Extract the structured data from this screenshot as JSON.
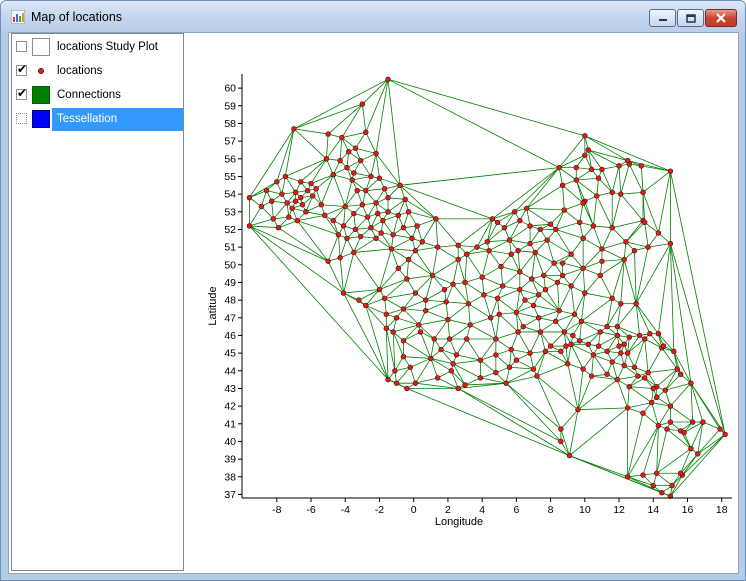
{
  "window": {
    "title": "Map of locations"
  },
  "legend": {
    "items": [
      {
        "label": "locations Study Plot",
        "checked": false,
        "swatch": "white-box",
        "fill": "#ffffff",
        "border": "#8e8f8f"
      },
      {
        "label": "locations",
        "checked": true,
        "swatch": "red-dot",
        "fill": "#e8191a"
      },
      {
        "label": "Connections",
        "checked": true,
        "swatch": "green-box",
        "fill": "#008000"
      },
      {
        "label": "Tessellation",
        "checked": false,
        "swatch": "blue-box",
        "fill": "#0000ff",
        "selected": true
      }
    ]
  },
  "colors": {
    "point_fill": "#e8191a",
    "point_stroke": "#3a1010",
    "edge": "#008000",
    "selection": "#3399ff"
  },
  "chart_data": {
    "type": "scatter",
    "xlabel": "Longitude",
    "ylabel": "Latitude",
    "xlim": [
      -9.8,
      18.6
    ],
    "ylim": [
      36.8,
      60.8
    ],
    "xticks": [
      -8,
      -6,
      -4,
      -2,
      0,
      2,
      4,
      6,
      8,
      10,
      12,
      14,
      16,
      18
    ],
    "yticks": [
      37,
      38,
      39,
      40,
      41,
      42,
      43,
      44,
      45,
      46,
      47,
      48,
      49,
      50,
      51,
      52,
      53,
      54,
      55,
      56,
      57,
      58,
      59,
      60
    ],
    "grid": false,
    "legend": "left-panel",
    "description_edges": "Delaunay triangulation connecting all locations",
    "points": [
      [
        -1.5,
        60.5
      ],
      [
        -3.0,
        59.1
      ],
      [
        -7.0,
        57.7
      ],
      [
        -5.0,
        57.4
      ],
      [
        -2.8,
        57.5
      ],
      [
        -3.4,
        56.6
      ],
      [
        -3.8,
        56.4
      ],
      [
        -5.1,
        56.0
      ],
      [
        -3.1,
        55.9
      ],
      [
        -4.3,
        55.9
      ],
      [
        -3.5,
        55.2
      ],
      [
        -2.5,
        55.0
      ],
      [
        -3.6,
        54.8
      ],
      [
        -2.0,
        54.9
      ],
      [
        -7.5,
        55.0
      ],
      [
        -6.6,
        54.7
      ],
      [
        -6.0,
        54.6
      ],
      [
        -8.0,
        54.7
      ],
      [
        -6.2,
        54.2
      ],
      [
        -6.9,
        54.1
      ],
      [
        -7.7,
        54.0
      ],
      [
        -8.6,
        54.2
      ],
      [
        -9.6,
        53.8
      ],
      [
        -8.9,
        53.3
      ],
      [
        -7.1,
        53.2
      ],
      [
        -6.5,
        53.4
      ],
      [
        -6.3,
        53.0
      ],
      [
        -7.3,
        52.7
      ],
      [
        -8.2,
        52.6
      ],
      [
        -6.8,
        52.5
      ],
      [
        -7.9,
        52.1
      ],
      [
        -9.6,
        52.2
      ],
      [
        -5.4,
        53.4
      ],
      [
        -4.0,
        53.3
      ],
      [
        -3.0,
        53.4
      ],
      [
        -2.2,
        53.5
      ],
      [
        -1.5,
        53.8
      ],
      [
        -0.5,
        53.7
      ],
      [
        -3.5,
        52.9
      ],
      [
        -2.7,
        52.7
      ],
      [
        -1.8,
        52.5
      ],
      [
        -0.9,
        52.8
      ],
      [
        -2.5,
        52.1
      ],
      [
        -3.4,
        52.0
      ],
      [
        -4.1,
        52.2
      ],
      [
        -3.1,
        51.6
      ],
      [
        -2.2,
        51.5
      ],
      [
        -1.2,
        51.7
      ],
      [
        -0.1,
        51.5
      ],
      [
        0.5,
        51.3
      ],
      [
        1.3,
        52.6
      ],
      [
        0.2,
        52.2
      ],
      [
        -1.5,
        53.0
      ],
      [
        -0.8,
        54.5
      ],
      [
        -2.8,
        54.2
      ],
      [
        -4.4,
        51.7
      ],
      [
        -4.3,
        50.4
      ],
      [
        -3.5,
        50.7
      ],
      [
        -5.0,
        50.2
      ],
      [
        -1.3,
        50.9
      ],
      [
        0.1,
        50.8
      ],
      [
        1.4,
        51.0
      ],
      [
        2.3,
        48.9
      ],
      [
        1.1,
        49.4
      ],
      [
        3.1,
        50.6
      ],
      [
        4.4,
        50.8
      ],
      [
        4.9,
        52.4
      ],
      [
        5.3,
        52.1
      ],
      [
        6.6,
        53.2
      ],
      [
        7.1,
        50.7
      ],
      [
        6.8,
        51.2
      ],
      [
        8.7,
        50.1
      ],
      [
        8.4,
        49.0
      ],
      [
        7.7,
        48.6
      ],
      [
        6.2,
        49.6
      ],
      [
        6.9,
        49.2
      ],
      [
        5.7,
        50.6
      ],
      [
        4.0,
        49.3
      ],
      [
        3.2,
        47.8
      ],
      [
        2.6,
        50.3
      ],
      [
        1.9,
        47.9
      ],
      [
        0.7,
        47.4
      ],
      [
        -0.6,
        47.5
      ],
      [
        -1.6,
        47.2
      ],
      [
        -2.8,
        47.7
      ],
      [
        -4.1,
        48.4
      ],
      [
        -1.7,
        48.1
      ],
      [
        -0.4,
        49.2
      ],
      [
        0.1,
        48.4
      ],
      [
        -1.6,
        46.4
      ],
      [
        -0.6,
        44.8
      ],
      [
        -1.2,
        46.2
      ],
      [
        0.3,
        46.6
      ],
      [
        1.2,
        45.8
      ],
      [
        2.1,
        45.8
      ],
      [
        3.1,
        45.8
      ],
      [
        4.8,
        45.8
      ],
      [
        5.7,
        45.2
      ],
      [
        6.1,
        46.2
      ],
      [
        7.3,
        47.0
      ],
      [
        7.4,
        46.2
      ],
      [
        8.5,
        47.4
      ],
      [
        9.2,
        48.8
      ],
      [
        10.0,
        48.4
      ],
      [
        11.6,
        48.1
      ],
      [
        12.1,
        47.8
      ],
      [
        13.0,
        47.8
      ],
      [
        14.3,
        46.1
      ],
      [
        13.8,
        46.1
      ],
      [
        11.3,
        46.5
      ],
      [
        10.2,
        45.5
      ],
      [
        9.2,
        45.5
      ],
      [
        8.6,
        45.1
      ],
      [
        7.7,
        45.1
      ],
      [
        7.2,
        43.7
      ],
      [
        5.4,
        43.3
      ],
      [
        4.8,
        43.9
      ],
      [
        3.9,
        43.6
      ],
      [
        2.3,
        44.4
      ],
      [
        1.4,
        43.6
      ],
      [
        0.1,
        43.3
      ],
      [
        -1.5,
        43.5
      ],
      [
        -1.0,
        43.3
      ],
      [
        -0.4,
        43.0
      ],
      [
        2.6,
        43.0
      ],
      [
        3.0,
        43.2
      ],
      [
        9.0,
        44.4
      ],
      [
        9.9,
        44.1
      ],
      [
        10.4,
        43.7
      ],
      [
        11.3,
        43.8
      ],
      [
        11.9,
        43.5
      ],
      [
        12.6,
        43.1
      ],
      [
        13.5,
        43.6
      ],
      [
        14.2,
        42.5
      ],
      [
        12.5,
        41.9
      ],
      [
        13.4,
        41.6
      ],
      [
        14.3,
        40.9
      ],
      [
        15.0,
        41.1
      ],
      [
        15.6,
        40.6
      ],
      [
        16.3,
        41.1
      ],
      [
        16.9,
        41.1
      ],
      [
        17.9,
        40.7
      ],
      [
        18.2,
        40.4
      ],
      [
        15.8,
        40.5
      ],
      [
        14.8,
        40.7
      ],
      [
        16.6,
        39.3
      ],
      [
        16.2,
        39.6
      ],
      [
        15.7,
        38.1
      ],
      [
        15.6,
        38.2
      ],
      [
        15.1,
        37.5
      ],
      [
        14.5,
        37.1
      ],
      [
        15.0,
        36.9
      ],
      [
        13.4,
        38.1
      ],
      [
        12.5,
        38.0
      ],
      [
        14.0,
        37.5
      ],
      [
        14.2,
        38.2
      ],
      [
        9.1,
        39.2
      ],
      [
        8.6,
        40.7
      ],
      [
        8.6,
        40.0
      ],
      [
        9.6,
        41.8
      ],
      [
        12.3,
        44.3
      ],
      [
        11.6,
        44.5
      ],
      [
        11.3,
        45.1
      ],
      [
        10.8,
        45.4
      ],
      [
        12.3,
        45.5
      ],
      [
        12.0,
        45.4
      ],
      [
        11.9,
        46.5
      ],
      [
        10.9,
        46.2
      ],
      [
        12.1,
        45.0
      ],
      [
        9.7,
        45.7
      ],
      [
        9.3,
        46.0
      ],
      [
        10.5,
        44.9
      ],
      [
        8.9,
        45.4
      ],
      [
        8.0,
        45.4
      ],
      [
        12.6,
        45.9
      ],
      [
        13.2,
        46.0
      ],
      [
        14.5,
        45.3
      ],
      [
        13.5,
        45.8
      ],
      [
        12.9,
        44.2
      ],
      [
        13.1,
        43.7
      ],
      [
        10.0,
        53.6
      ],
      [
        9.9,
        53.5
      ],
      [
        10.7,
        53.9
      ],
      [
        11.6,
        54.1
      ],
      [
        12.1,
        54.0
      ],
      [
        13.4,
        54.1
      ],
      [
        13.4,
        52.5
      ],
      [
        11.6,
        52.1
      ],
      [
        12.4,
        51.3
      ],
      [
        10.5,
        52.2
      ],
      [
        9.7,
        52.4
      ],
      [
        8.8,
        53.1
      ],
      [
        7.8,
        51.4
      ],
      [
        8.3,
        52.0
      ],
      [
        9.9,
        51.5
      ],
      [
        11.0,
        50.9
      ],
      [
        13.7,
        51.0
      ],
      [
        12.9,
        50.8
      ],
      [
        10.9,
        49.4
      ],
      [
        9.9,
        49.8
      ],
      [
        11.0,
        50.2
      ],
      [
        12.3,
        50.3
      ],
      [
        8.2,
        50.1
      ],
      [
        7.6,
        49.4
      ],
      [
        8.7,
        49.4
      ],
      [
        9.2,
        50.6
      ],
      [
        10.0,
        56.2
      ],
      [
        12.6,
        55.7
      ],
      [
        10.4,
        55.4
      ],
      [
        9.5,
        55.5
      ],
      [
        8.5,
        55.5
      ],
      [
        10.2,
        56.5
      ],
      [
        12.0,
        55.6
      ],
      [
        12.5,
        55.9
      ],
      [
        11.0,
        55.4
      ],
      [
        10.8,
        54.9
      ],
      [
        9.5,
        54.8
      ],
      [
        8.7,
        54.5
      ],
      [
        13.3,
        55.6
      ],
      [
        15.0,
        55.3
      ],
      [
        10.0,
        57.3
      ],
      [
        13.5,
        52.4
      ],
      [
        15.0,
        51.2
      ],
      [
        14.3,
        51.8
      ],
      [
        14.6,
        45.4
      ],
      [
        15.2,
        45.1
      ],
      [
        15.4,
        44.1
      ],
      [
        15.6,
        43.8
      ],
      [
        16.2,
        43.3
      ],
      [
        15.0,
        42.0
      ],
      [
        14.7,
        42.9
      ],
      [
        14.2,
        43.1
      ],
      [
        13.7,
        43.9
      ],
      [
        14.0,
        43.0
      ],
      [
        13.9,
        42.2
      ],
      [
        12.5,
        45.0
      ],
      [
        11.9,
        46.0
      ],
      [
        4.5,
        47.0
      ],
      [
        5.0,
        47.2
      ],
      [
        6.0,
        47.3
      ],
      [
        3.3,
        46.6
      ],
      [
        2.0,
        46.9
      ],
      [
        0.4,
        46.2
      ],
      [
        -0.6,
        45.7
      ],
      [
        1.6,
        45.2
      ],
      [
        2.5,
        44.9
      ],
      [
        3.9,
        44.6
      ],
      [
        4.8,
        44.9
      ],
      [
        5.6,
        44.2
      ],
      [
        6.8,
        45.0
      ],
      [
        6.0,
        44.6
      ],
      [
        7.0,
        44.1
      ],
      [
        -0.2,
        44.2
      ],
      [
        1.0,
        44.7
      ],
      [
        2.2,
        44.0
      ],
      [
        -1.1,
        44.0
      ],
      [
        5.1,
        49.9
      ],
      [
        5.2,
        48.8
      ],
      [
        4.1,
        48.3
      ],
      [
        4.9,
        48.1
      ],
      [
        6.2,
        48.6
      ],
      [
        6.5,
        48.0
      ],
      [
        7.3,
        48.3
      ],
      [
        3.0,
        49.0
      ],
      [
        1.8,
        48.6
      ],
      [
        -0.9,
        49.8
      ],
      [
        -2.0,
        48.6
      ],
      [
        -3.2,
        48.0
      ],
      [
        -1.0,
        47.0
      ],
      [
        0.7,
        48.0
      ],
      [
        -0.3,
        50.3
      ],
      [
        2.6,
        51.1
      ],
      [
        4.3,
        51.3
      ],
      [
        3.7,
        51.0
      ],
      [
        5.6,
        51.4
      ],
      [
        6.1,
        50.8
      ],
      [
        6.8,
        52.2
      ],
      [
        6.2,
        52.5
      ],
      [
        7.4,
        52.0
      ],
      [
        8.0,
        52.3
      ],
      [
        5.9,
        53.0
      ],
      [
        4.6,
        52.6
      ],
      [
        7.0,
        47.7
      ],
      [
        6.4,
        46.5
      ],
      [
        8.3,
        46.8
      ],
      [
        9.4,
        47.2
      ],
      [
        9.8,
        46.8
      ],
      [
        8.8,
        46.2
      ],
      [
        -2.2,
        56.3
      ],
      [
        -4.2,
        57.2
      ],
      [
        -3.9,
        55.5
      ],
      [
        -4.7,
        55.1
      ],
      [
        -3.3,
        54.2
      ],
      [
        -1.7,
        54.3
      ],
      [
        -5.7,
        54.3
      ],
      [
        -5.9,
        53.9
      ],
      [
        -6.6,
        53.8
      ],
      [
        -7.4,
        53.5
      ],
      [
        -8.3,
        53.6
      ],
      [
        -6.9,
        53.6
      ],
      [
        -5.2,
        52.8
      ],
      [
        -4.7,
        52.5
      ],
      [
        -3.9,
        51.5
      ],
      [
        -1.9,
        51.8
      ],
      [
        -0.6,
        52.1
      ],
      [
        -2.1,
        52.9
      ],
      [
        -0.3,
        53.0
      ]
    ]
  }
}
